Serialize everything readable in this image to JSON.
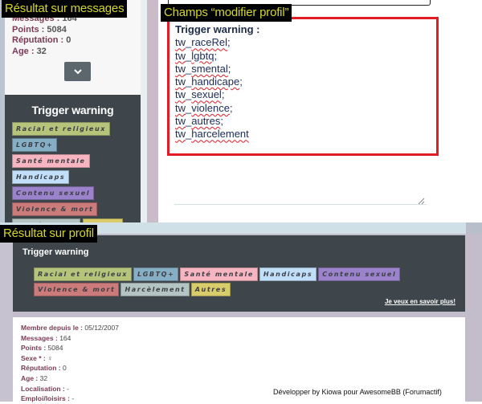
{
  "captions": {
    "messages": "Résultat sur messages",
    "edit_profile": "Champs “modifier profil”",
    "profile": "Résultat sur profil"
  },
  "message_sidebar": {
    "stats": [
      {
        "label": "Messages",
        "value": "164"
      },
      {
        "label": "Points",
        "value": "5084"
      },
      {
        "label": "Réputation",
        "value": "0"
      },
      {
        "label": "Age",
        "value": "32"
      }
    ],
    "expand_icon": "chevron-down-icon"
  },
  "trigger_warning": {
    "title": "Trigger warning",
    "tags": [
      {
        "label": "Racial et religieux",
        "color": "#b5c37b"
      },
      {
        "label": "LGBTQ+",
        "color": "#86aec4"
      },
      {
        "label": "Santé mentale",
        "color": "#f6b5c0"
      },
      {
        "label": "Handicaps",
        "color": "#c2dffa"
      },
      {
        "label": "Contenu sexuel",
        "color": "#9b83cc"
      },
      {
        "label": "Violence & mort",
        "color": "#cc7b7b"
      },
      {
        "label": "Harcèlement",
        "color": "#b3c4c2"
      },
      {
        "label": "Autres",
        "color": "#d9cd6b"
      }
    ]
  },
  "edit_field": {
    "header": "Trigger warning :",
    "lines": [
      "tw_raceRel;",
      "tw_lgbtq;",
      "tw_smental;",
      "tw_handicape;",
      "tw_sexuel;",
      "tw_violence;",
      "tw_autres;",
      "tw_harcelement"
    ]
  },
  "profile": {
    "tw_title": "Trigger warning",
    "learn_more": "Je veux en savoir plus!",
    "stats": [
      {
        "label": "Membre depuis le",
        "value": "05/12/2007"
      },
      {
        "label": "Messages",
        "value": "164"
      },
      {
        "label": "Points",
        "value": "5084"
      },
      {
        "label": "Sexe *",
        "value": "♀"
      },
      {
        "label": "Réputation",
        "value": "0"
      },
      {
        "label": "Age",
        "value": "32"
      },
      {
        "label": "Localisation",
        "value": "-"
      },
      {
        "label": "Emploi/loisirs",
        "value": "-"
      }
    ]
  },
  "credit": "Développer by Kiowa pour AwesomeBB (Forumactif)"
}
